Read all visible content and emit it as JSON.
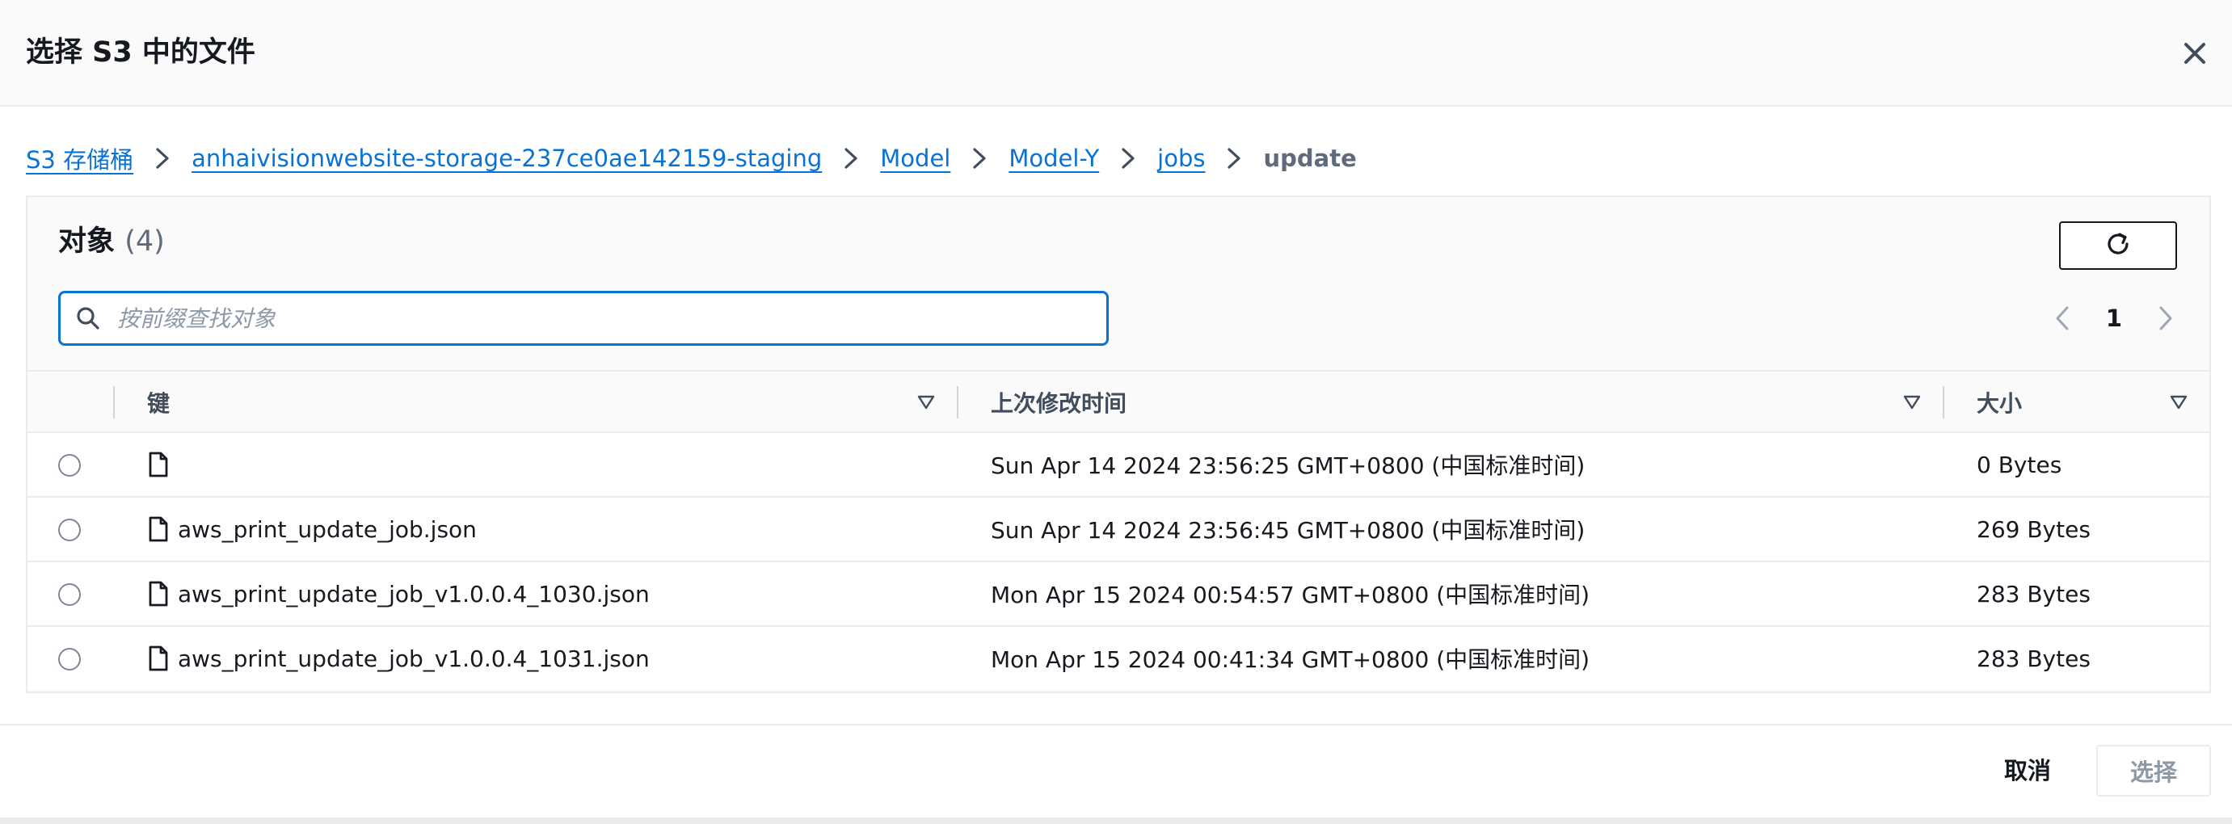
{
  "modal": {
    "title": "选择 S3 中的文件",
    "close_icon": "close-icon"
  },
  "breadcrumb": {
    "items": [
      "S3 存储桶",
      "anhaivisionwebsite-storage-237ce0ae142159-staging",
      "Model",
      "Model-Y",
      "jobs"
    ],
    "current": "update",
    "separator_icon": "chevron-right-icon"
  },
  "objects_panel": {
    "title": "对象",
    "count": "(4)",
    "refresh_icon": "refresh-icon",
    "search": {
      "placeholder": "按前缀查找对象",
      "value": "",
      "icon": "search-icon"
    },
    "pagination": {
      "current_page": "1",
      "prev_icon": "chevron-left-icon",
      "next_icon": "chevron-right-icon"
    },
    "table": {
      "columns": [
        "键",
        "上次修改时间",
        "大小"
      ],
      "sort_icon": "sort-caret-down-icon",
      "rows": [
        {
          "key": "",
          "modified": "Sun Apr 14 2024 23:56:25 GMT+0800 (中国标准时间)",
          "size": "0 Bytes"
        },
        {
          "key": "aws_print_update_job.json",
          "modified": "Sun Apr 14 2024 23:56:45 GMT+0800 (中国标准时间)",
          "size": "269 Bytes"
        },
        {
          "key": "aws_print_update_job_v1.0.0.4_1030.json",
          "modified": "Mon Apr 15 2024 00:54:57 GMT+0800 (中国标准时间)",
          "size": "283 Bytes"
        },
        {
          "key": "aws_print_update_job_v1.0.0.4_1031.json",
          "modified": "Mon Apr 15 2024 00:41:34 GMT+0800 (中国标准时间)",
          "size": "283 Bytes"
        }
      ]
    }
  },
  "footer": {
    "cancel_label": "取消",
    "select_label": "选择"
  },
  "colors": {
    "link": "#0972d3",
    "text": "#16191f",
    "muted": "#5f6b7a",
    "border": "#e9ebed",
    "disabled": "#8d99a8"
  }
}
